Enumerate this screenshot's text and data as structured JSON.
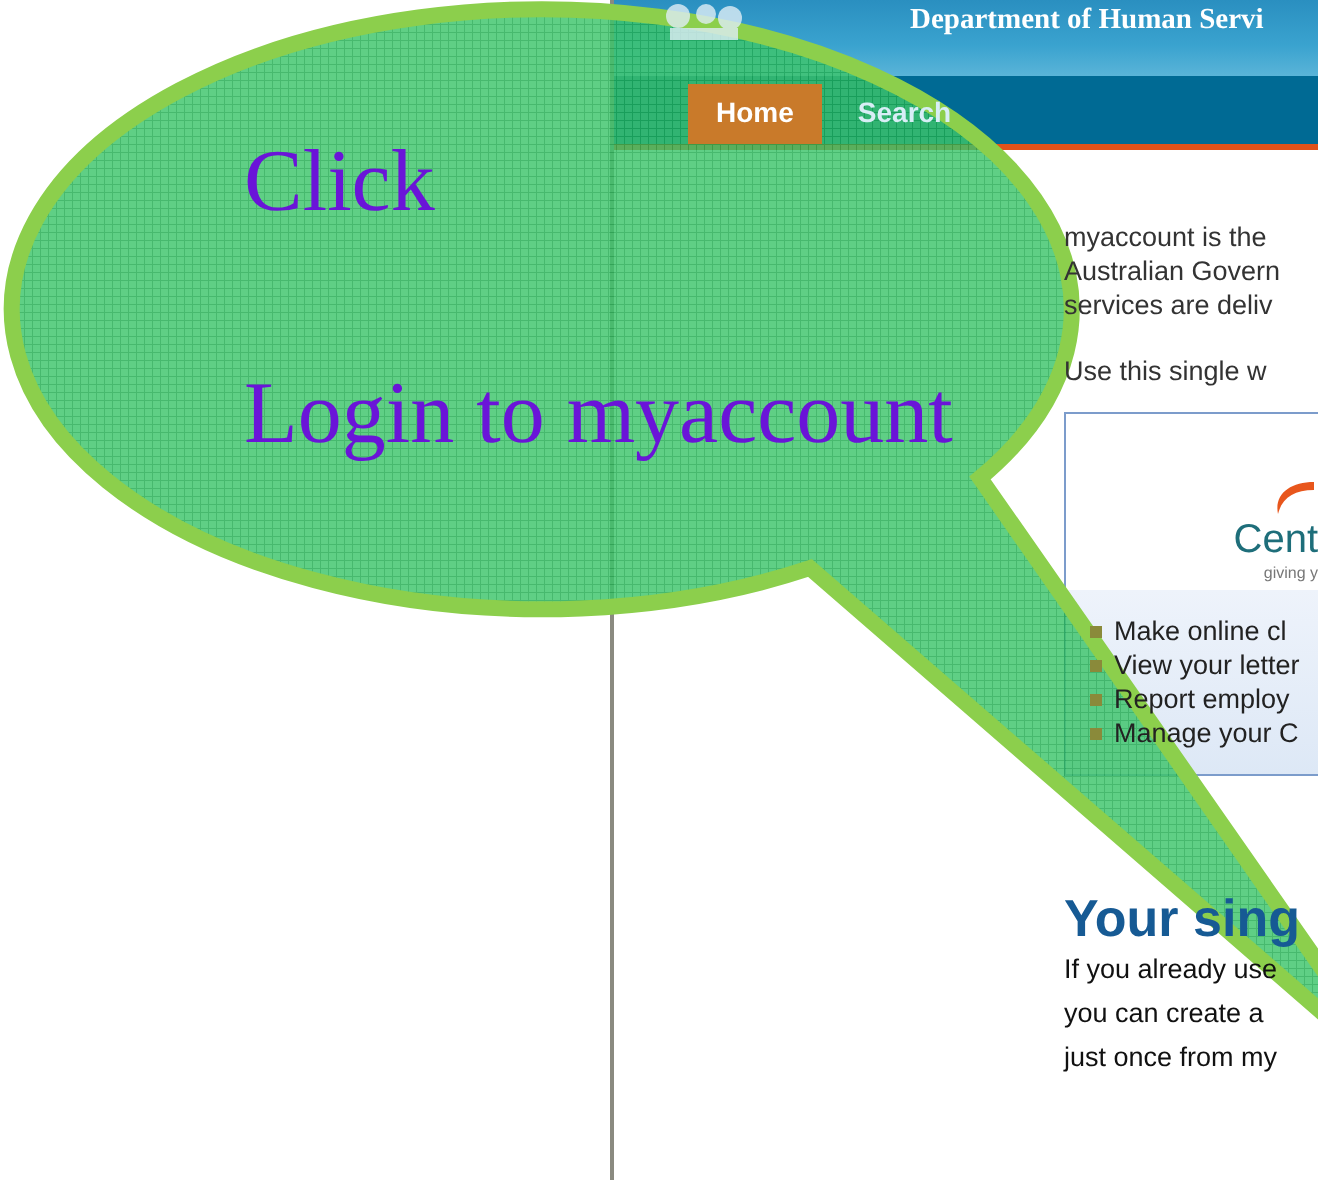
{
  "header": {
    "title": "Department of Human Servi"
  },
  "nav": [
    {
      "label": "Home",
      "selected": true
    },
    {
      "label": "Search",
      "selected": false
    }
  ],
  "intro": [
    "myaccount is the",
    "Australian Govern",
    "services are deliv"
  ],
  "intro_2": "Use this single w",
  "service_box": {
    "logo_text": "Cent",
    "tagline": "giving y",
    "items": [
      "Make online cl",
      "View your letter",
      "Report employ",
      "Manage your C"
    ]
  },
  "heading": "Your sing",
  "paragraph": [
    "If you already use",
    "you can create a",
    "just once from my"
  ],
  "callout": {
    "lines": [
      "Click",
      "Login to myaccount"
    ]
  }
}
